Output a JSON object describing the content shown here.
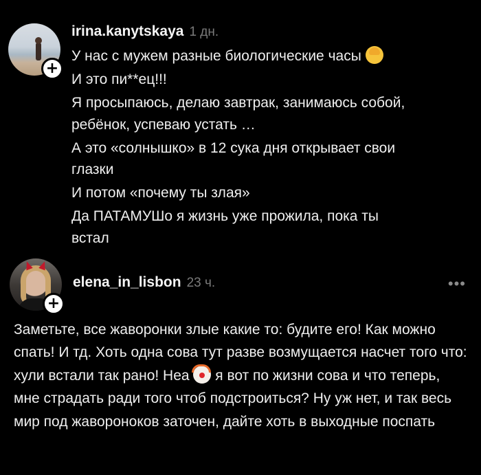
{
  "comments": [
    {
      "username": "irina.kanytskaya",
      "time": "1 дн.",
      "avatar_icon": "avatar-beach-photo",
      "follow_symbol": "+",
      "lines": [
        "У нас с мужем разные биологические часы",
        "И это пи**ец!!!",
        "Я просыпаюсь, делаю завтрак, занимаюсь собой,",
        "ребёнок, успеваю устать …",
        "А это «солнышко» в 12 сука дня открывает свои",
        "глазки",
        "И потом «почему ты злая»",
        "Да ПАТАМУШо  я жизнь уже прожила, пока ты",
        "встал"
      ],
      "emoji": "woman-facepalming"
    },
    {
      "username": "elena_in_lisbon",
      "time": "23 ч.",
      "avatar_icon": "avatar-portrait-photo",
      "follow_symbol": "+",
      "more_symbol": "•••",
      "text_1": "Заметьте, все жаворонки злые какие то: будите его! Как можно спать! И тд. Хоть одна сова тут разве возмущается насчет того что: хули встали так рано! Неа ",
      "text_2": " я вот по жизни сова и что теперь, мне страдать ради того чтоб подстроиться? Ну уж нет, и так весь мир под жавороноков заточен, дайте хоть в выходные поспать",
      "emoji": "clown-face"
    }
  ]
}
